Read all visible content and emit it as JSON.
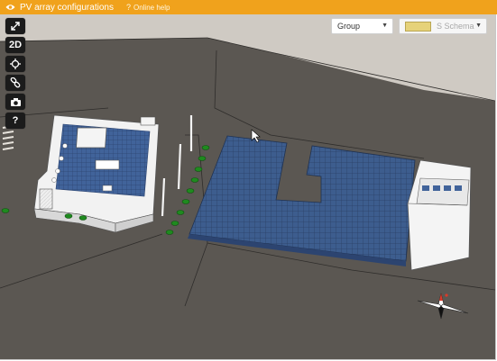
{
  "titlebar": {
    "title": "PV array configurations",
    "help_label": "Online help",
    "eye_icon": "eye-icon",
    "help_icon": "question-icon"
  },
  "toolbar": {
    "buttons": [
      {
        "icon": "expand-icon",
        "label": ""
      },
      {
        "icon": "view-2d",
        "label": "2D"
      },
      {
        "icon": "crosshair-icon",
        "label": ""
      },
      {
        "icon": "link-icon",
        "label": ""
      },
      {
        "icon": "camera-icon",
        "label": ""
      },
      {
        "icon": "question-icon",
        "label": "?"
      }
    ]
  },
  "selectors": {
    "group": {
      "selected": "Group"
    },
    "schema": {
      "selected": "S Schema"
    }
  },
  "colors": {
    "titlebar": "#f0a21c",
    "ground": "#5a5651",
    "sidewalk": "#cfcac3",
    "panels": "#3f5f8f",
    "trees": "#1f8a1f",
    "buildings": "#eeeeee"
  }
}
